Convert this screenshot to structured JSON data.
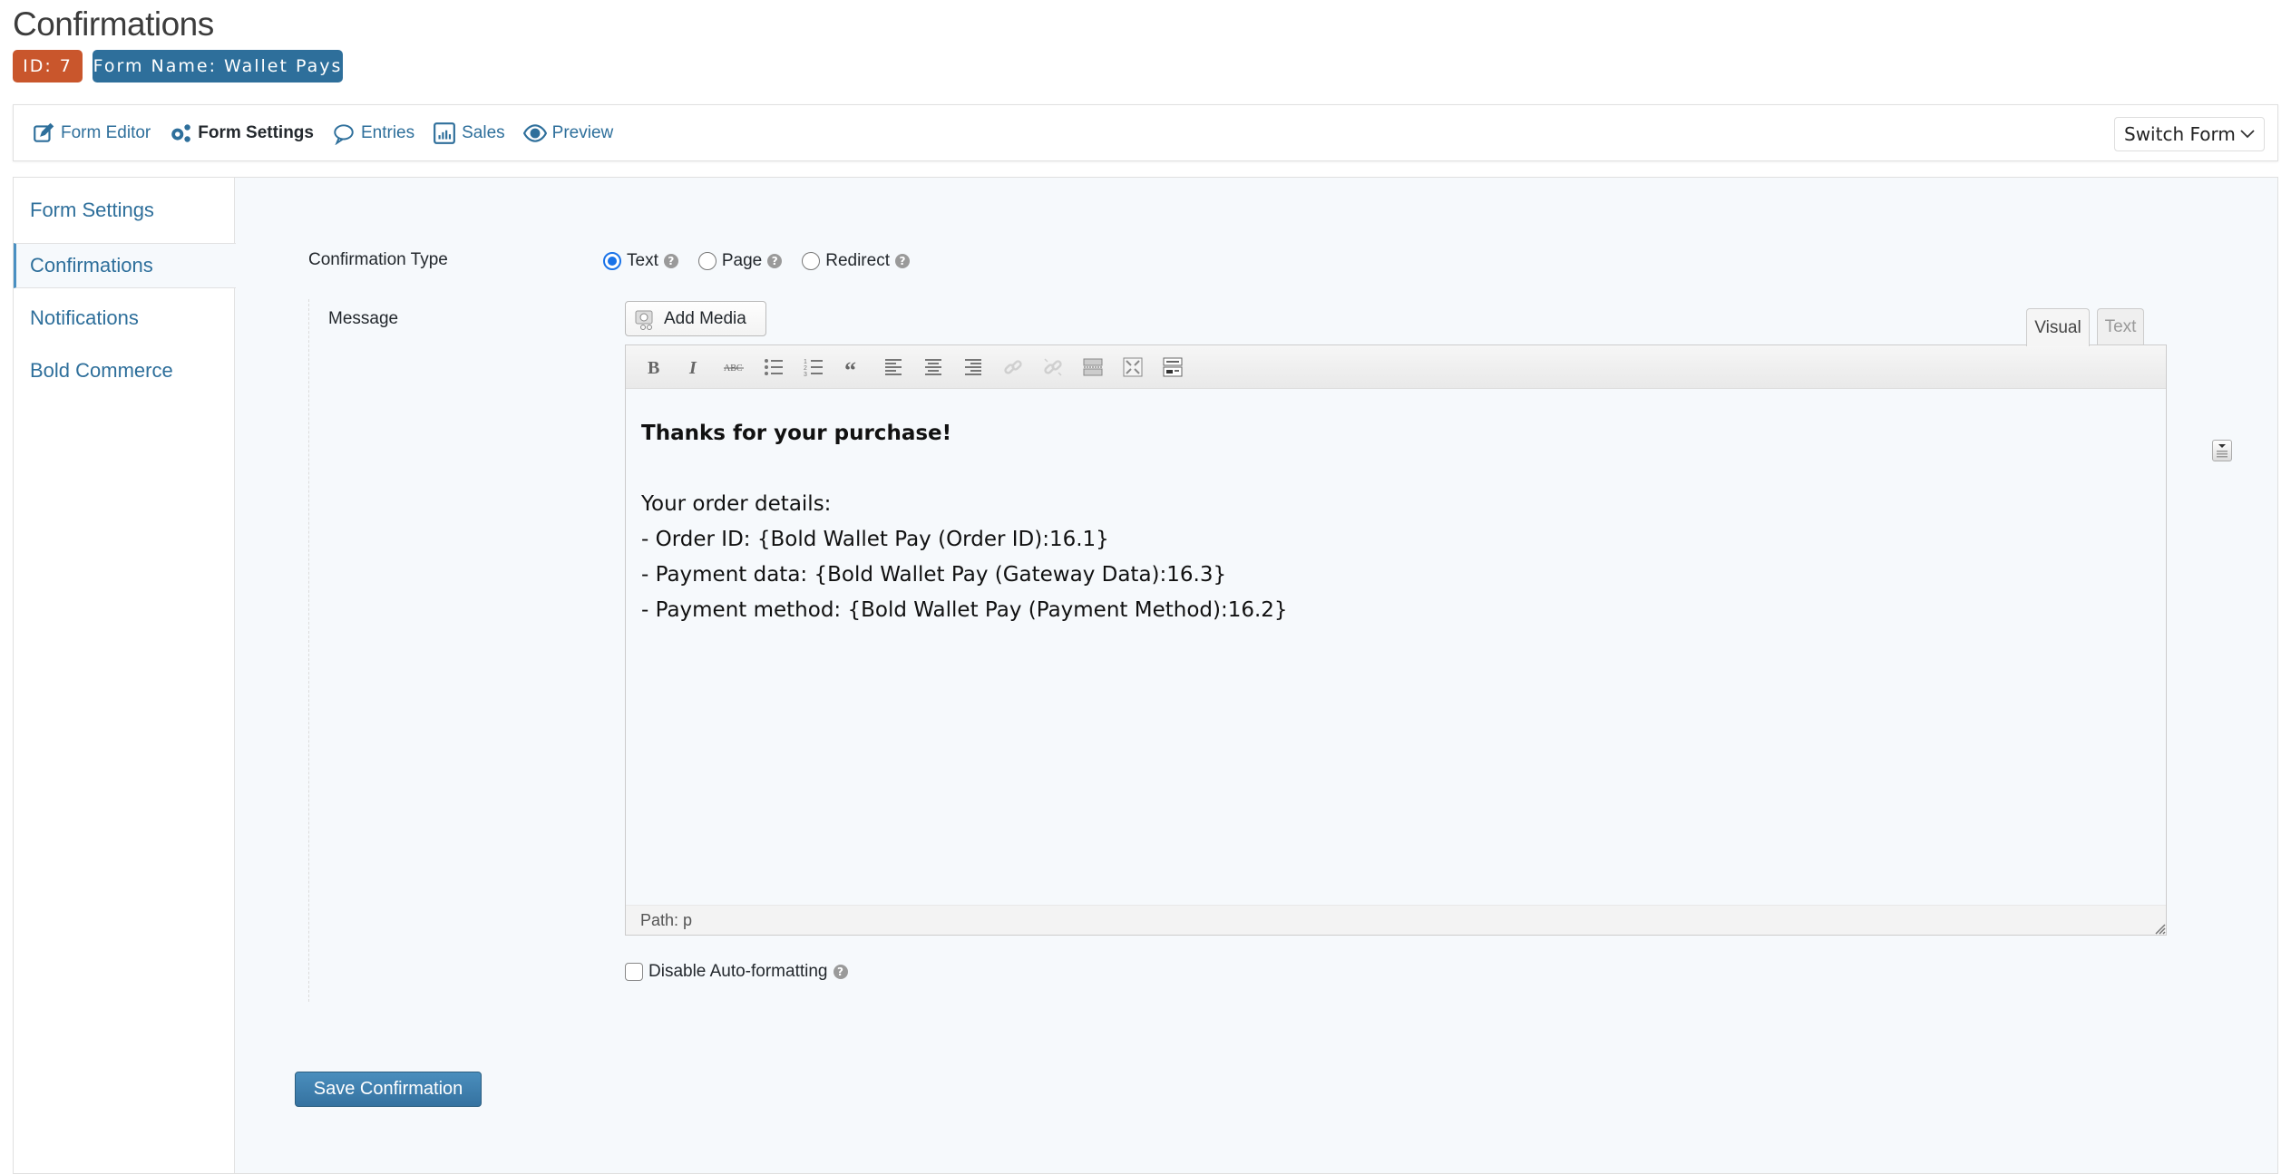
{
  "header": {
    "title": "Confirmations",
    "id_badge": "ID: 7",
    "form_name_badge": "Form Name: Wallet Pays"
  },
  "topnav": {
    "items": [
      {
        "label": "Form Editor",
        "icon": "pencil-square-icon",
        "active": false
      },
      {
        "label": "Form Settings",
        "icon": "gears-icon",
        "active": true
      },
      {
        "label": "Entries",
        "icon": "speech-bubble-icon",
        "active": false
      },
      {
        "label": "Sales",
        "icon": "bar-chart-icon",
        "active": false
      },
      {
        "label": "Preview",
        "icon": "eye-icon",
        "active": false
      }
    ],
    "switch_form": "Switch Form"
  },
  "sidebar": {
    "items": [
      {
        "label": "Form Settings",
        "active": false
      },
      {
        "label": "Confirmations",
        "active": true
      },
      {
        "label": "Notifications",
        "active": false
      },
      {
        "label": "Bold Commerce",
        "active": false
      }
    ]
  },
  "form": {
    "confirmation_type_label": "Confirmation Type",
    "confirmation_types": [
      {
        "label": "Text",
        "checked": true
      },
      {
        "label": "Page",
        "checked": false
      },
      {
        "label": "Redirect",
        "checked": false
      }
    ],
    "message_label": "Message",
    "add_media": "Add Media",
    "tabs": {
      "visual": "Visual",
      "text": "Text",
      "active": "Visual"
    },
    "toolbar": [
      "bold",
      "italic",
      "strikethrough",
      "bulleted-list",
      "numbered-list",
      "blockquote",
      "align-left",
      "align-center",
      "align-right",
      "insert-link",
      "remove-link",
      "read-more",
      "fullscreen",
      "toolbar-toggle"
    ],
    "message": {
      "heading": "Thanks for your purchase!",
      "lines": [
        "Your order details:",
        "- Order ID: {Bold Wallet Pay (Order ID):16.1}",
        "- Payment data: {Bold Wallet Pay (Gateway Data):16.3}",
        "- Payment method: {Bold Wallet Pay (Payment Method):16.2}"
      ]
    },
    "path": "Path: p",
    "disable_autoformat": {
      "label": "Disable Auto-formatting",
      "checked": false
    },
    "help_glyph": "?",
    "save_button": "Save Confirmation"
  },
  "colors": {
    "accent": "#2e6f9b",
    "id_badge": "#c9562c",
    "radio_checked": "#1a73e8",
    "panel_bg": "#f6f9fc"
  }
}
